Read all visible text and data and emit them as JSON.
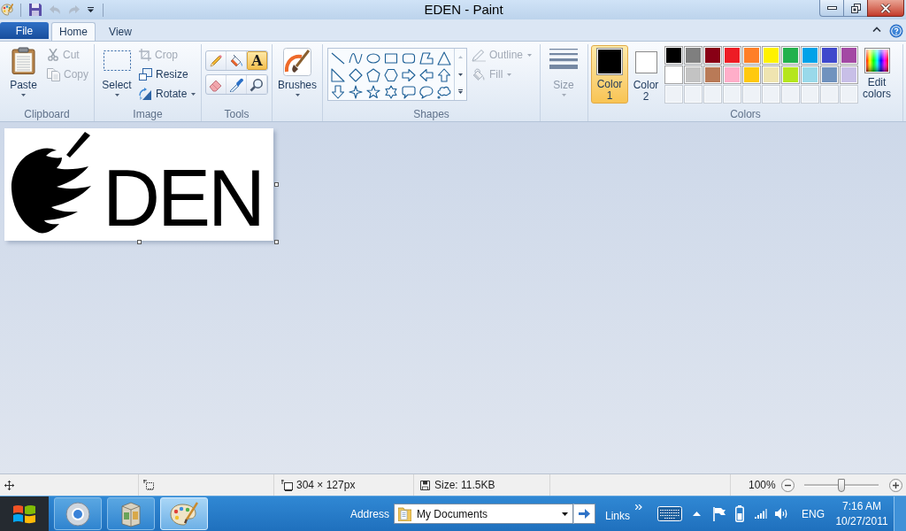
{
  "window": {
    "title": "EDEN - Paint"
  },
  "quick_access": {
    "undo": {
      "disabled": true
    },
    "redo": {
      "disabled": true
    }
  },
  "tabs": [
    {
      "label": "File",
      "kind": "application_menu",
      "selected": false
    },
    {
      "label": "Home",
      "kind": "tab",
      "selected": true
    },
    {
      "label": "View",
      "kind": "tab",
      "selected": false
    }
  ],
  "ribbon": {
    "clipboard": {
      "label": "Clipboard",
      "paste": {
        "label": "Paste"
      },
      "cut": {
        "label": "Cut",
        "disabled": true
      },
      "copy": {
        "label": "Copy",
        "disabled": true
      }
    },
    "image": {
      "label": "Image",
      "select": {
        "label": "Select"
      },
      "crop": {
        "label": "Crop",
        "disabled": true
      },
      "resize": {
        "label": "Resize",
        "disabled": false
      },
      "rotate": {
        "label": "Rotate",
        "disabled": false
      }
    },
    "tools": {
      "label": "Tools",
      "items": [
        {
          "selected": false
        },
        {
          "selected": false
        },
        {
          "glyph": "A",
          "selected": true
        },
        {
          "selected": false
        },
        {
          "selected": false
        },
        {
          "selected": false
        }
      ]
    },
    "brushes": {
      "label": "Brushes"
    },
    "shapes": {
      "label": "Shapes",
      "outline": {
        "label": "Outline",
        "disabled": true
      },
      "fill": {
        "label": "Fill",
        "disabled": true
      }
    },
    "size": {
      "label": "Size",
      "disabled": true
    },
    "colors": {
      "label": "Colors",
      "color_1": {
        "label": "Color 1",
        "color": "#000000",
        "selected": true
      },
      "color_2": {
        "label": "Color 2",
        "color": "#ffffff",
        "selected": false
      },
      "palette": [
        {
          "kind": "swatch",
          "color": "#000000"
        },
        {
          "kind": "swatch",
          "color": "#7f7f7f"
        },
        {
          "kind": "swatch",
          "color": "#880015"
        },
        {
          "kind": "swatch",
          "color": "#ed1c24"
        },
        {
          "kind": "swatch",
          "color": "#ff7f27"
        },
        {
          "kind": "swatch",
          "color": "#fff200"
        },
        {
          "kind": "swatch",
          "color": "#22b14c"
        },
        {
          "kind": "swatch",
          "color": "#00a2e8"
        },
        {
          "kind": "swatch",
          "color": "#3f48cc"
        },
        {
          "kind": "swatch",
          "color": "#a349a4"
        },
        {
          "kind": "swatch",
          "color": "#ffffff"
        },
        {
          "kind": "swatch",
          "color": "#c3c3c3"
        },
        {
          "kind": "swatch",
          "color": "#b97a57"
        },
        {
          "kind": "swatch",
          "color": "#ffaec9"
        },
        {
          "kind": "swatch",
          "color": "#ffc90e"
        },
        {
          "kind": "swatch",
          "color": "#efe4b0"
        },
        {
          "kind": "swatch",
          "color": "#b5e61d"
        },
        {
          "kind": "swatch",
          "color": "#99d9ea"
        },
        {
          "kind": "swatch",
          "color": "#7092be"
        },
        {
          "kind": "swatch",
          "color": "#c8bfe7"
        },
        {
          "kind": "empty_slot"
        },
        {
          "kind": "empty_slot"
        },
        {
          "kind": "empty_slot"
        },
        {
          "kind": "empty_slot"
        },
        {
          "kind": "empty_slot"
        },
        {
          "kind": "empty_slot"
        },
        {
          "kind": "empty_slot"
        },
        {
          "kind": "empty_slot"
        },
        {
          "kind": "empty_slot"
        },
        {
          "kind": "empty_slot"
        }
      ],
      "edit_colors": {
        "label": "Edit colors"
      }
    }
  },
  "canvas": {
    "image_text": "DEN"
  },
  "status_bar": {
    "image_size": "304 × 127px",
    "file_size": "Size: 11.5KB",
    "zoom": "100%",
    "zoom_slider": {
      "level": 0.5
    }
  },
  "taskbar": {
    "apps": [
      {
        "selected": false
      },
      {
        "selected": false
      },
      {
        "selected": true
      }
    ],
    "address": {
      "label": "Address",
      "value": "My Documents"
    },
    "links": "Links",
    "language": "ENG",
    "time": "7:16 AM",
    "date": "10/27/2011"
  }
}
